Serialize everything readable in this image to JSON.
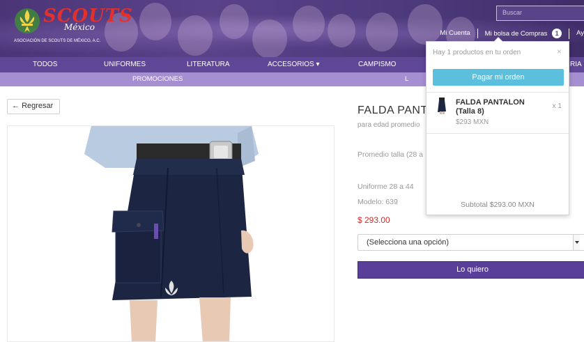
{
  "header": {
    "logo_scouts": "SCOUTS",
    "logo_mexico": "México",
    "logo_subtitle": "ASOCIACIÓN DE SCOUTS DE MÉXICO, A.C.",
    "search_placeholder": "Buscar",
    "links": {
      "account": "Mi Cuenta",
      "bag": "Mi bolsa de Compras",
      "bag_count": "1",
      "help": "Ay"
    }
  },
  "nav": {
    "items": [
      "TODOS",
      "UNIFORMES",
      "LITERATURA",
      "ACCESORIOS ▾",
      "CAMPISMO",
      "RIA"
    ],
    "sub_items": [
      "PROMOCIONES",
      "L"
    ]
  },
  "product": {
    "back_label": "Regresar",
    "title": "FALDA PANTA",
    "subtitle": "para edad promedio",
    "talla_note": "Promedio talla (28 a",
    "uniforme": "Uniforme 28 a 44",
    "modelo": "Modelo: 639",
    "price": "$ 293.00",
    "select_value": "(Selecciona una opción)",
    "buy_label": "Lo quiero"
  },
  "cart": {
    "header": "Hay 1 productos en tu orden",
    "close": "×",
    "pay_label": "Pagar mi orden",
    "item_name": "FALDA PANTALON (Talla 8)",
    "item_price": "$293 MXN",
    "item_qty": "x 1",
    "subtotal": "Subtotal $293.00 MXN"
  },
  "colors": {
    "nav": "#5f4697",
    "subnav": "#a58fd0",
    "accent_button": "#5a3f9a",
    "pay_button": "#5bc0de",
    "price": "#c9302c"
  }
}
